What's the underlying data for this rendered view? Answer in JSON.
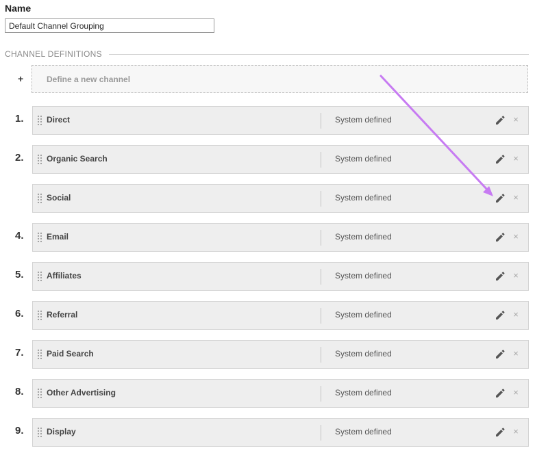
{
  "name_label": "Name",
  "name_value": "Default Channel Grouping",
  "section_title": "CHANNEL DEFINITIONS",
  "new_channel": {
    "plus": "+",
    "label": "Define a new channel"
  },
  "delete_symbol": "×",
  "icons": {
    "drag": "drag-handle-icon",
    "edit": "pencil-icon",
    "delete": "close-icon"
  },
  "colors": {
    "annotation_arrow": "#c77bf2",
    "row_background": "#eeeeee"
  },
  "channels": [
    {
      "number": "1.",
      "name": "Direct",
      "type": "System defined"
    },
    {
      "number": "2.",
      "name": "Organic Search",
      "type": "System defined"
    },
    {
      "number": "",
      "name": "Social",
      "type": "System defined"
    },
    {
      "number": "4.",
      "name": "Email",
      "type": "System defined"
    },
    {
      "number": "5.",
      "name": "Affiliates",
      "type": "System defined"
    },
    {
      "number": "6.",
      "name": "Referral",
      "type": "System defined"
    },
    {
      "number": "7.",
      "name": "Paid Search",
      "type": "System defined"
    },
    {
      "number": "8.",
      "name": "Other Advertising",
      "type": "System defined"
    },
    {
      "number": "9.",
      "name": "Display",
      "type": "System defined"
    }
  ]
}
